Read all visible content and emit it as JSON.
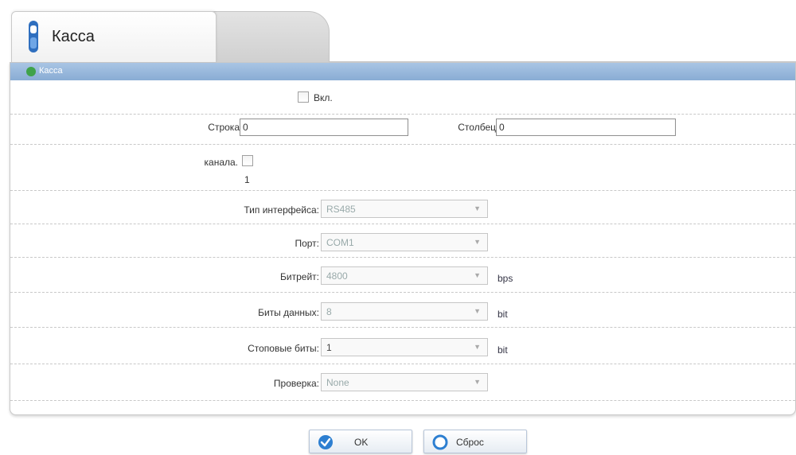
{
  "tabs": [
    {
      "label": "Касса"
    }
  ],
  "section": {
    "title": "Касса"
  },
  "form": {
    "enable": {
      "label": "Вкл.",
      "checked": false
    },
    "row": {
      "label": "Строка",
      "value": "0"
    },
    "column": {
      "label": "Столбец",
      "value": "0"
    },
    "channel": {
      "label": "канала.",
      "number": "1",
      "checked": false
    },
    "interface_type": {
      "label": "Тип интерфейса:",
      "value": "RS485"
    },
    "port": {
      "label": "Порт:",
      "value": "COM1"
    },
    "baud_rate": {
      "label": "Битрейт:",
      "value": "4800",
      "unit": "bps"
    },
    "data_bits": {
      "label": "Биты данных:",
      "value": "8",
      "unit": "bit"
    },
    "stop_bits": {
      "label": "Стоповые биты:",
      "value": "1",
      "unit": "bit"
    },
    "parity": {
      "label": "Проверка:",
      "value": "None"
    }
  },
  "buttons": {
    "ok": {
      "label": "OK"
    },
    "reset": {
      "label": "Сброс"
    }
  },
  "colors": {
    "header_blue": "#89acd4",
    "ok_icon": "#2d7fd1",
    "reset_icon": "#2d7fd1",
    "section_icon": "#3fa24a"
  },
  "icons": {
    "tab": "cash-register-icon",
    "section": "green-dot-icon",
    "ok": "checkmark-icon",
    "reset": "reset-circle-icon",
    "dropdown": "chevron-down-icon"
  }
}
